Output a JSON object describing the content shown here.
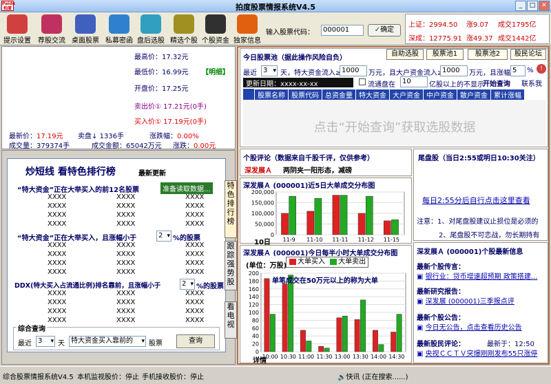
{
  "window": {
    "title": "拍度股票情报系统V4.5",
    "logo": "Paidu 拍度"
  },
  "toolbar": [
    {
      "label": "提示设置",
      "color": "#d04040"
    },
    {
      "label": "荐股交流",
      "color": "#c03060"
    },
    {
      "label": "桌面股票",
      "color": "#4060c0"
    },
    {
      "label": "私募密函",
      "color": "#3080d0"
    },
    {
      "label": "盘后选股",
      "color": "#30a0c0"
    },
    {
      "label": "精选个股",
      "color": "#a09020"
    },
    {
      "label": "个股资金",
      "color": "#303030"
    },
    {
      "label": "独家信息",
      "color": "#e06010"
    }
  ],
  "code_input": {
    "label": "输入股票代码：",
    "value": "000001",
    "button": "确定"
  },
  "quote": {
    "sh_label": "上证：",
    "sh_value": "2994.50",
    "sh_up_label": "涨",
    "sh_up": "9.07",
    "sh_vol_label": "成交",
    "sh_vol": "1795亿",
    "sz_label": "深成：",
    "sz_value": "12775.91",
    "sz_up_label": "涨",
    "sz_up": "49.37",
    "sz_vol_label": "成交",
    "sz_vol": "1442亿"
  },
  "stock_info": {
    "high": "最高价：17.32元",
    "low": "最低价：16.99元",
    "open": "开盘价：17.25元",
    "detail_btn": "【明细】",
    "sell1": "卖出价① 17.21元(0手)",
    "buy1": "买入价① 17.19元(0手)",
    "last_label": "最新价：",
    "last": "17.19元",
    "sell_label": "卖盘↓",
    "sell_qty": "1336手",
    "chg_label": "涨跌幅：",
    "chg": "0.00%",
    "vol": "成交量：379374手",
    "amount": "成交金额：65042万元",
    "chg2_label": "涨跌：",
    "chg2": "0.00元"
  },
  "hot": {
    "title": "炒短线 看特色排行榜",
    "updated": "最新更新",
    "s1": "“特大资金”正在大举买入的前12名股票",
    "s1_btn": "准备读取数据...",
    "s2": "“特大资金”正在大举买入，且涨幅小于",
    "s2_val": "2",
    "s2_unit": "%的股票",
    "s3": "DDX(特大买入占流通比例)排名靠前，且涨幅小于",
    "s3_val": "2",
    "s3_unit": "%的股票",
    "placeholder": "XXXX",
    "combo_title": "综合查询",
    "combo_recent": "最近",
    "combo_days": "3",
    "combo_day_unit": "天",
    "combo_sel": "特大资金买入靠前的",
    "combo_stock": "股票",
    "combo_btn": "查询"
  },
  "vtabs": [
    "特色排行榜",
    "跟踪强势股",
    "看电视"
  ],
  "pick": {
    "title": "今日股票池（据此操作风险自负）",
    "tabs": [
      "自助选股",
      "股票池1",
      "股票池2",
      "股民论坛"
    ],
    "recent": "最近",
    "days": "3",
    "text1": "天，特大资金流入≥",
    "v1": "1000",
    "text2": "万元，且大户资金流入≥",
    "v2": "1000",
    "text3": "万元，且涨幅≤",
    "v3": "5",
    "pct": "%",
    "update_label": "更新日期：",
    "update_val": "xxxx-xx-xx",
    "flow_check": "流通盘在",
    "flow_val": "10",
    "flow_text": "亿股以上的不显示",
    "start_btn": "开始查询",
    "contact": "联系我",
    "columns": [
      "股票名称",
      "股票代码",
      "总资金量",
      "特大资金",
      "大户资金",
      "中户资金",
      "散户资金",
      "累计涨幅"
    ],
    "placeholder": "点击“开始查询”获取选股数据"
  },
  "comment": {
    "title": "个股评论（数据来自千股千评，仅供参考）",
    "stock": "深发展Ａ",
    "text": "两阴夹一阳形态，减磅"
  },
  "chart1": {
    "title": "深发展Ａ (000001)近5日大单成交分布图",
    "corner": "10日"
  },
  "chart2": {
    "title": "深发展Ａ (000001)今日每半小时大单成交分布图",
    "unit": "(单位：万股)",
    "buy": "大单买入",
    "sell": "大单卖出",
    "note": "单笔成交在50万元以上的称为大单",
    "detail": "详情"
  },
  "chart_data": [
    {
      "type": "bar",
      "title": "深发展Ａ (000001)近5日大单成交分布图",
      "categories": [
        "11-9",
        "11-10",
        "11-11",
        "11-12",
        "11-15"
      ],
      "series": [
        {
          "name": "大单买入",
          "values": [
            100000,
            110000,
            185000,
            100000,
            65000
          ]
        },
        {
          "name": "大单卖出",
          "values": [
            180000,
            170000,
            185000,
            180000,
            70000
          ]
        }
      ],
      "ylim": [
        0,
        200000
      ],
      "yticks": [
        "200,000",
        "150,000",
        "100,000",
        "50,000",
        "0"
      ]
    },
    {
      "type": "bar",
      "title": "深发展Ａ (000001)今日每半小时大单成交分布图",
      "ylabel": "(单位：万股)",
      "categories": [
        "10:00",
        "10:30",
        "11:00",
        "11:30",
        "13:00",
        "13:30",
        "14:00",
        "14:30"
      ],
      "series": [
        {
          "name": "大单买入",
          "values": [
            205,
            190,
            60,
            15,
            95,
            90,
            60,
            55
          ]
        },
        {
          "name": "大单卖出",
          "values": [
            105,
            215,
            30,
            10,
            100,
            145,
            20,
            105
          ]
        }
      ],
      "ylim": [
        0,
        220
      ],
      "yticks": [
        "200",
        "180",
        "160",
        "140",
        "120",
        "100",
        "80",
        "60",
        "40",
        "20",
        "0"
      ]
    }
  ],
  "tail": {
    "title": "尾盘股（当日2:55或明日10:30关注）",
    "link": "每日2:55分后自行点击这里查看",
    "note1": "注意：1、对尾盘股建议止损位是必须的",
    "note2": "2、尾盘股不可恋战，勿长期持有"
  },
  "news": {
    "title": "深发展Ａ (000001)个股最新信息",
    "h1": "最新个股传言：",
    "i1": "银行业：贷币增速超预期 政策搭建...",
    "h2": "最新研究报告：",
    "i2": "深发展 (000001)三季报点评",
    "h3": "最新个股公告：",
    "i3": "今日无公告，点击查看历史公告",
    "h4": "最新股民评论：",
    "time": "最新于：12:50",
    "i4": "央视ＣＣＴＶ突爆刚刚发布55只涨停"
  },
  "status": {
    "left": "综合股票情报系统V4.5",
    "monitor": "本机监视股价：停止",
    "phone": "手机接收股价：停止",
    "news": "🔊快讯 (正在搜索......)"
  }
}
